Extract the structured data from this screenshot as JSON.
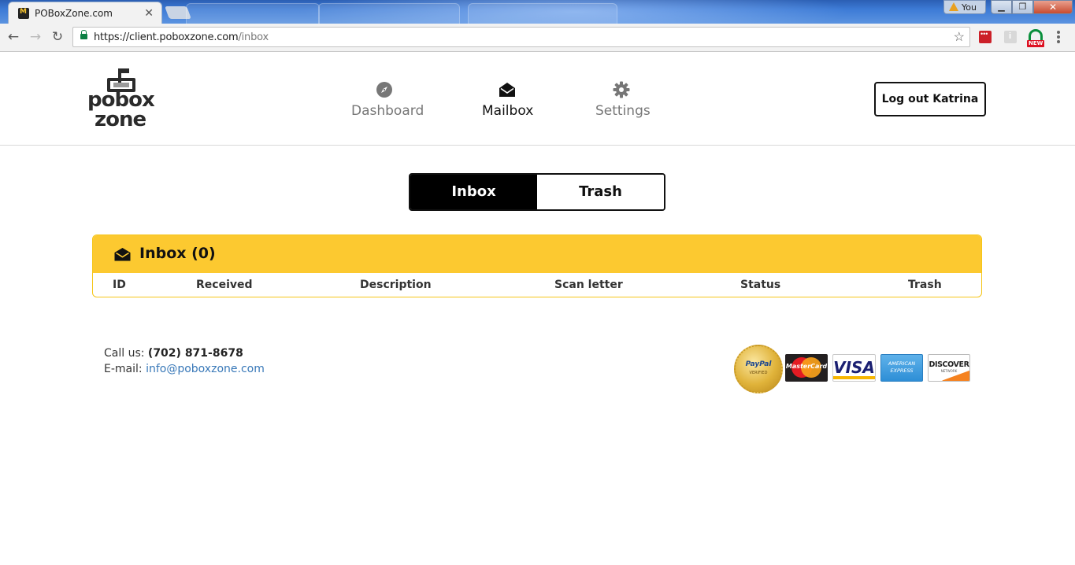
{
  "browser": {
    "tab_title": "POBoxZone.com",
    "tab_close": "✕",
    "user_label": "You",
    "url_host": "https://client.poboxzone.com",
    "url_path": "/inbox",
    "new_badge": "NEW"
  },
  "header": {
    "logo_line1": "pobox",
    "logo_line2": "zone",
    "nav": {
      "dashboard": "Dashboard",
      "mailbox": "Mailbox",
      "settings": "Settings"
    },
    "active_nav": "mailbox",
    "logout_label": "Log out Katrina"
  },
  "toggle": {
    "inbox": "Inbox",
    "trash": "Trash",
    "selected": "inbox"
  },
  "inbox": {
    "title": "Inbox (0)",
    "columns": [
      "ID",
      "Received",
      "Description",
      "Scan letter",
      "Status",
      "Trash"
    ],
    "rows": []
  },
  "footer": {
    "call_label": "Call us:",
    "phone": "(702) 871-8678",
    "email_label": "E-mail:",
    "email": "info@poboxzone.com",
    "payment": {
      "paypal": "PayPal",
      "paypal_sub": "VERIFIED",
      "mastercard": "MasterCard",
      "visa": "VISA",
      "amex_line1": "AMERICAN",
      "amex_line2": "EXPRESS",
      "discover": "DISCOVER",
      "discover_sub": "NETWORK"
    }
  },
  "colors": {
    "accent_yellow": "#fcc930",
    "active_black": "#000000",
    "link_blue": "#3878b8"
  },
  "icons": {
    "dashboard": "compass-icon",
    "mailbox": "envelope-open-icon",
    "settings": "gear-icon"
  }
}
